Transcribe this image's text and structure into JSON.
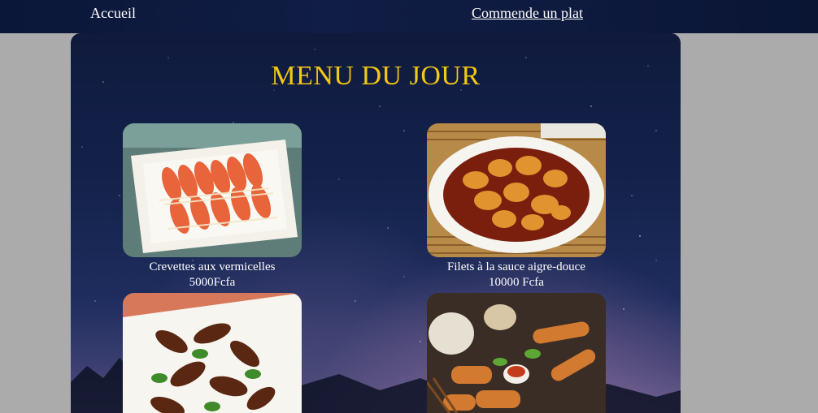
{
  "nav": {
    "home_label": "Accueil",
    "order_label": "Commende un plat"
  },
  "menu": {
    "title": "MENU DU JOUR",
    "dishes": [
      {
        "name": "Crevettes aux vermicelles",
        "price": "5000Fcfa",
        "photo": "shrimp-vermicelli-photo"
      },
      {
        "name": "Filets à la sauce aigre-douce",
        "price": "10000 Fcfa",
        "photo": "sweet-sour-fillets-photo"
      },
      {
        "name": "",
        "price": "",
        "photo": "eggplant-stirfry-photo"
      },
      {
        "name": "",
        "price": "",
        "photo": "spring-rolls-photo"
      }
    ]
  },
  "colors": {
    "title": "#f2c811",
    "topbar": "#0e1a3e",
    "page_background": "#ababab",
    "text": "#ffffff"
  }
}
